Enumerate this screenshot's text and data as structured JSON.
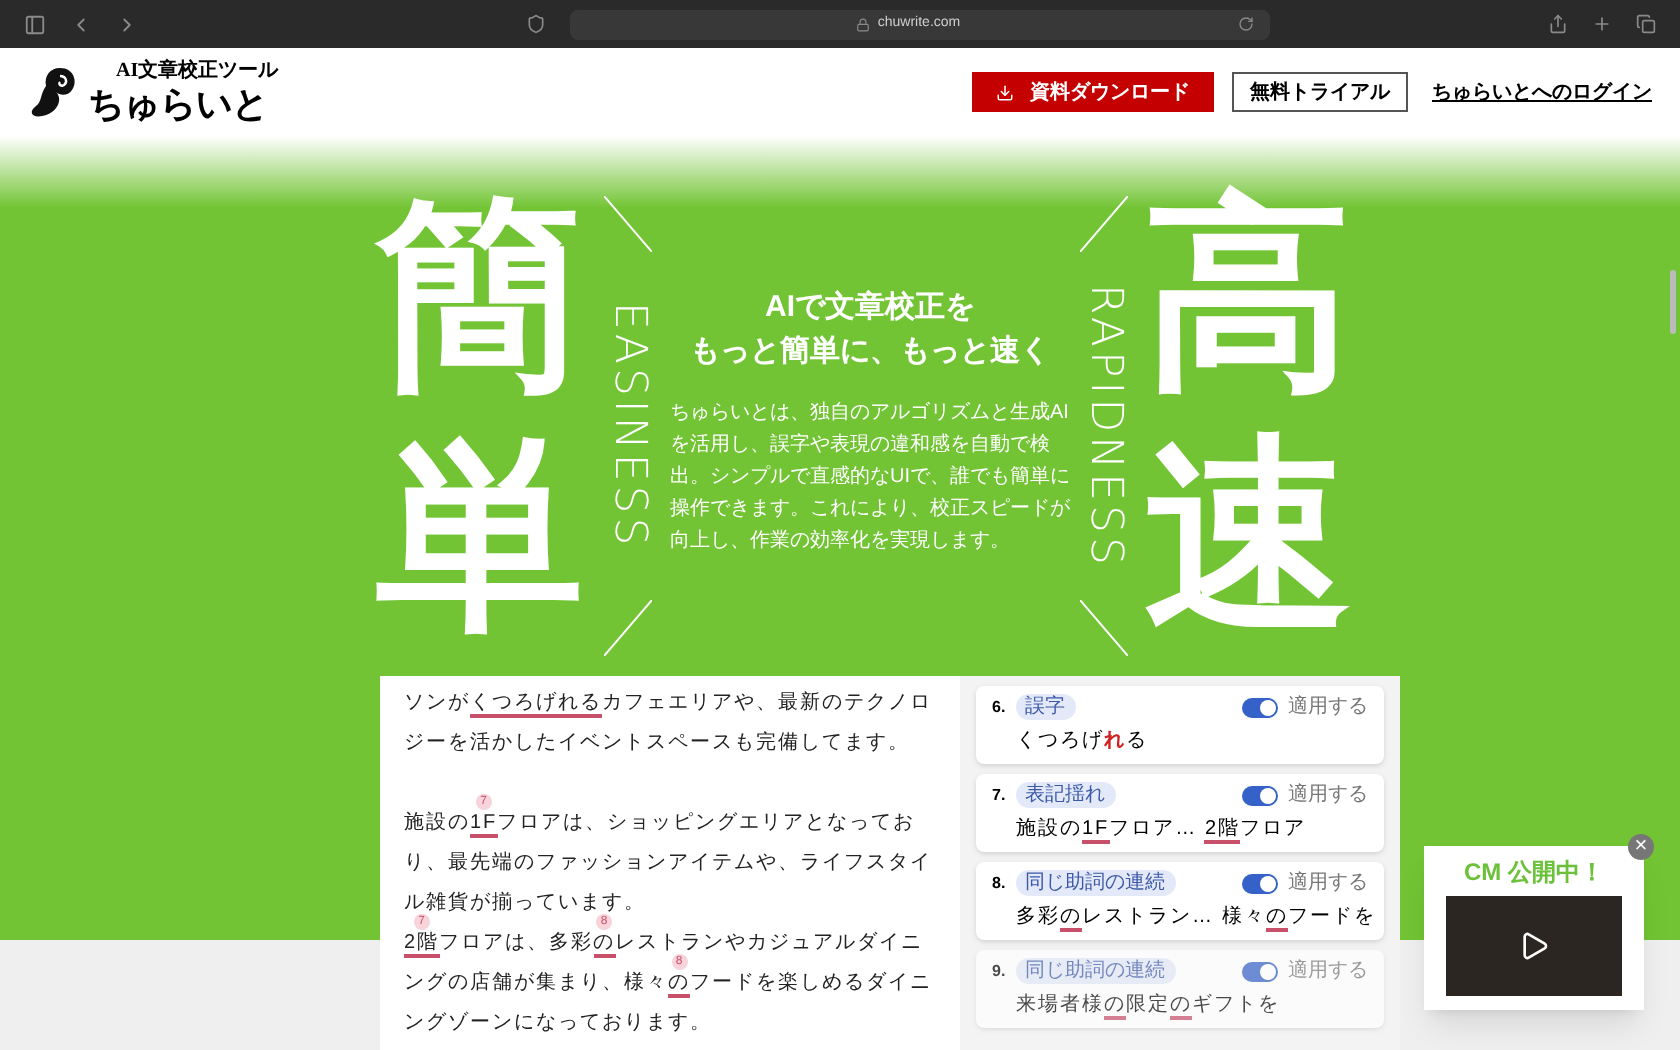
{
  "browser": {
    "url": "chuwrite.com"
  },
  "header": {
    "logo": {
      "tagline": "AI文章校正ツール",
      "name": "ちゅらいと"
    },
    "download_button": "資料ダウンロード",
    "trial_button": "無料トライアル",
    "login_link": "ちゅらいとへのログイン"
  },
  "hero": {
    "left_big": "簡単",
    "left_label": "EASINESS",
    "right_big": "高速",
    "right_label": "RAPIDNESS",
    "heading": [
      "AIで文章校正を",
      "もっと簡単に、もっと速く"
    ],
    "description": "ちゅらいとは、独自のアルゴリズムと生成AIを活用し、誤字や表現の違和感を自動で検出。シンプルで直感的なUIで、誰でも簡単に操作できます。これにより、校正スピードが向上し、作業の効率化を実現します。"
  },
  "article": {
    "paragraphs": [
      {
        "gap_before": false,
        "segments": [
          {
            "text": "ソンが"
          },
          {
            "text": "くつろげれる",
            "marked": true
          },
          {
            "text": "カフェエリアや、最新のテクノロジーを活かしたイベントスペースも完備してます。"
          }
        ]
      },
      {
        "gap_before": true,
        "segments": [
          {
            "text": "施設の"
          },
          {
            "text": "1F",
            "marked": true,
            "note": "7"
          },
          {
            "text": "フロアは、ショッピングエリアとなっており、最先端のファッションアイテムや、ライフスタイル雑貨が揃っています。"
          }
        ]
      },
      {
        "gap_before": false,
        "segments": [
          {
            "text": "2階",
            "marked": true,
            "note": "7"
          },
          {
            "text": "フロアは、多彩"
          },
          {
            "text": "の",
            "marked": true,
            "note": "8"
          },
          {
            "text": "レストランやカジュアルダイニングの店舗が集まり、様々"
          },
          {
            "text": "の",
            "marked": true,
            "note": "8"
          },
          {
            "text": "フードを楽しめるダイニングゾーンになっております。"
          }
        ]
      }
    ]
  },
  "suggestions": [
    {
      "number": "6.",
      "tag": "誤字",
      "applied": true,
      "toggle_label": "適用する",
      "faded": false,
      "excerpt": [
        {
          "text": "くつろげ",
          "kind": "plain"
        },
        {
          "text": "れ",
          "kind": "error"
        },
        {
          "text": "る",
          "kind": "plain"
        }
      ]
    },
    {
      "number": "7.",
      "tag": "表記揺れ",
      "applied": true,
      "toggle_label": "適用する",
      "faded": false,
      "excerpt": [
        {
          "text": "施設の",
          "kind": "plain"
        },
        {
          "text": "1F",
          "kind": "underline"
        },
        {
          "text": "フロア… ",
          "kind": "plain"
        },
        {
          "text": "2階",
          "kind": "underline"
        },
        {
          "text": "フロア",
          "kind": "plain"
        }
      ]
    },
    {
      "number": "8.",
      "tag": "同じ助詞の連続",
      "applied": true,
      "toggle_label": "適用する",
      "faded": false,
      "excerpt": [
        {
          "text": "多彩",
          "kind": "plain"
        },
        {
          "text": "の",
          "kind": "underline"
        },
        {
          "text": "レストラン… 様々",
          "kind": "plain"
        },
        {
          "text": "の",
          "kind": "underline"
        },
        {
          "text": "フードを",
          "kind": "plain"
        }
      ]
    },
    {
      "number": "9.",
      "tag": "同じ助詞の連続",
      "applied": true,
      "toggle_label": "適用する",
      "faded": true,
      "excerpt": [
        {
          "text": "来場者様",
          "kind": "plain"
        },
        {
          "text": "の",
          "kind": "underline"
        },
        {
          "text": "限定",
          "kind": "plain"
        },
        {
          "text": "の",
          "kind": "underline"
        },
        {
          "text": "ギフトを",
          "kind": "plain"
        }
      ]
    }
  ],
  "popup": {
    "title": "CM 公開中！",
    "close": "×"
  }
}
